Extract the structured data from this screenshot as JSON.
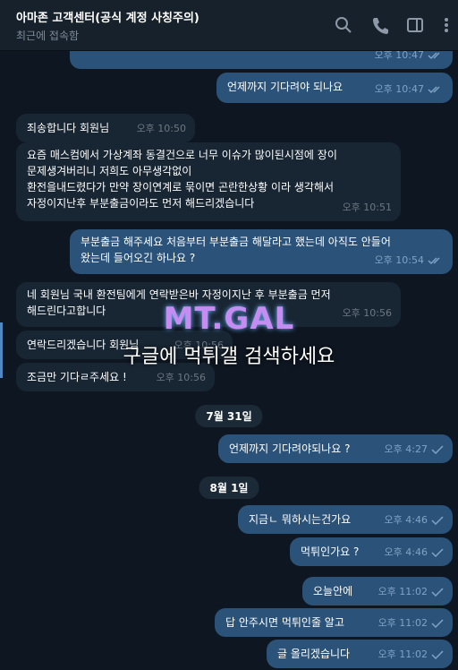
{
  "header": {
    "title": "아마존 고객센터(공식 계정 사칭주의)",
    "status": "최근에 접속함",
    "icons": [
      "search-icon",
      "phone-icon",
      "sidebar-icon",
      "more-icon"
    ]
  },
  "messages": [
    {
      "dir": "out",
      "text": "",
      "time": "오후 10:47",
      "read": true
    },
    {
      "dir": "out",
      "text": "언제까지 기다려야 되나요",
      "time": "오후 10:47",
      "read": true
    },
    {
      "dir": "in",
      "text": "죄송합니다 회원님",
      "time": "오후 10:50"
    },
    {
      "dir": "in",
      "lines": [
        "요즘 매스컴에서 가상계좌 동결건으로 너무 이슈가 많이된시점에 장이",
        "문제생겨버리니 저희도 아무생각없이",
        " 환전을내드렸다가 만약 장이연계로 묶이면 곤란한상황 이라 생각해서",
        "자정이지난후 부분출금이라도 먼저 해드리겠습니다"
      ],
      "time": "오후 10:51"
    },
    {
      "dir": "out",
      "lines": [
        "부분출금 해주세요 처음부터 부분출금 해달라고 했는데 아직도 안들어",
        "왔는데 들어오긴 하나요 ?"
      ],
      "time": "오후 10:54",
      "read": true
    },
    {
      "dir": "in",
      "lines": [
        "네 회원님 국내 환전팀에게 연락받은바 자정이지난 후 부분출금 먼저",
        "해드린다고합니다"
      ],
      "time": "오후 10:56"
    },
    {
      "dir": "in",
      "text": "연락드리겠습니다 회원님",
      "time": "오후 10:56"
    },
    {
      "dir": "in",
      "text": "조금만 기다ㄹ주세요 !",
      "time": "오후 10:56"
    },
    {
      "dir": "date",
      "text": "7월 31일"
    },
    {
      "dir": "out",
      "text": "언제까지 기다려야되나요 ?",
      "time": "오후 4:27",
      "read": false
    },
    {
      "dir": "date",
      "text": "8월 1일"
    },
    {
      "dir": "out",
      "text": "지금ㄴ 뭐하시는건가요",
      "time": "오후 4:46",
      "read": false
    },
    {
      "dir": "out",
      "text": "먹튀인가요 ?",
      "time": "오후 4:46",
      "read": false
    },
    {
      "dir": "out",
      "text": "오늘안에",
      "time": "오후 11:02",
      "read": false
    },
    {
      "dir": "out",
      "text": "답 안주시면 먹튀인줄 알고",
      "time": "오후 11:02",
      "read": false
    },
    {
      "dir": "out",
      "text": "글 올리겠습니다",
      "time": "오후 11:02",
      "read": false
    }
  ],
  "watermark": {
    "logo": "MT.GAL",
    "text": "구글에 먹튀갤 검색하세요"
  },
  "colors": {
    "bg": "#0e1621",
    "header": "#17212b",
    "outgoing": "#2b5278",
    "incoming": "#182533",
    "accent": "#5288c1"
  }
}
